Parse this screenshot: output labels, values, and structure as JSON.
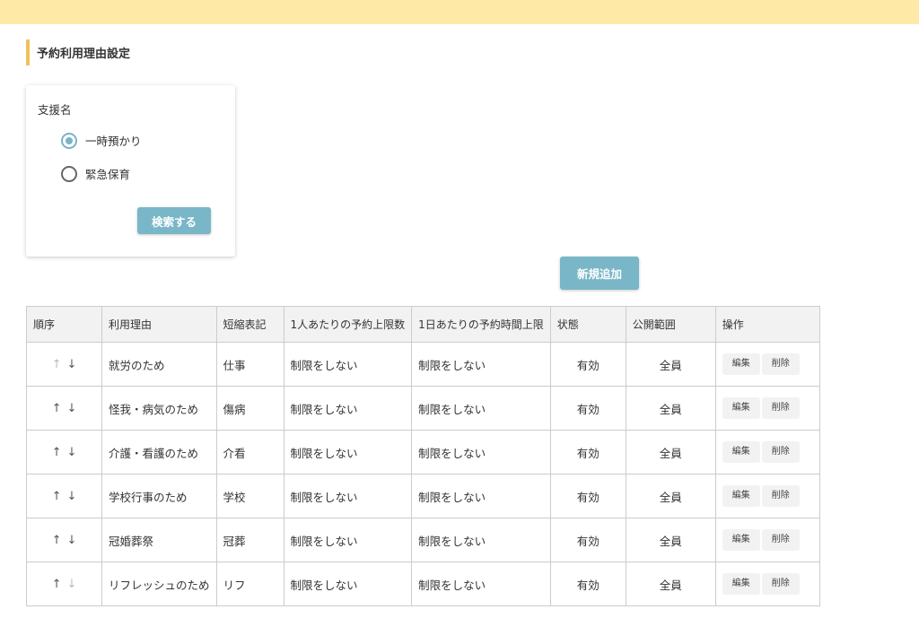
{
  "page": {
    "title": "予約利用理由設定"
  },
  "search": {
    "label": "支援名",
    "options": [
      {
        "label": "一時預かり",
        "selected": true
      },
      {
        "label": "緊急保育",
        "selected": false
      }
    ],
    "button_label": "検索する"
  },
  "actions": {
    "add_label": "新規追加"
  },
  "table": {
    "headers": [
      "順序",
      "利用理由",
      "短縮表記",
      "1人あたりの予約上限数",
      "1日あたりの予約時間上限",
      "状態",
      "公開範囲",
      "操作"
    ],
    "edit_label": "編集",
    "delete_label": "削除",
    "rows": [
      {
        "reason": "就労のため",
        "short": "仕事",
        "per_person_limit": "制限をしない",
        "per_day_limit": "制限をしない",
        "status": "有効",
        "scope": "全員"
      },
      {
        "reason": "怪我・病気のため",
        "short": "傷病",
        "per_person_limit": "制限をしない",
        "per_day_limit": "制限をしない",
        "status": "有効",
        "scope": "全員"
      },
      {
        "reason": "介護・看護のため",
        "short": "介看",
        "per_person_limit": "制限をしない",
        "per_day_limit": "制限をしない",
        "status": "有効",
        "scope": "全員"
      },
      {
        "reason": "学校行事のため",
        "short": "学校",
        "per_person_limit": "制限をしない",
        "per_day_limit": "制限をしない",
        "status": "有効",
        "scope": "全員"
      },
      {
        "reason": "冠婚葬祭",
        "short": "冠葬",
        "per_person_limit": "制限をしない",
        "per_day_limit": "制限をしない",
        "status": "有効",
        "scope": "全員"
      },
      {
        "reason": "リフレッシュのため",
        "short": "リフ",
        "per_person_limit": "制限をしない",
        "per_day_limit": "制限をしない",
        "status": "有効",
        "scope": "全員"
      }
    ]
  },
  "colors": {
    "topbar": "#ffe9a6",
    "title_accent": "#f0c15a",
    "primary_button": "#79b6c7",
    "radio_checked": "#7ab4c8"
  }
}
